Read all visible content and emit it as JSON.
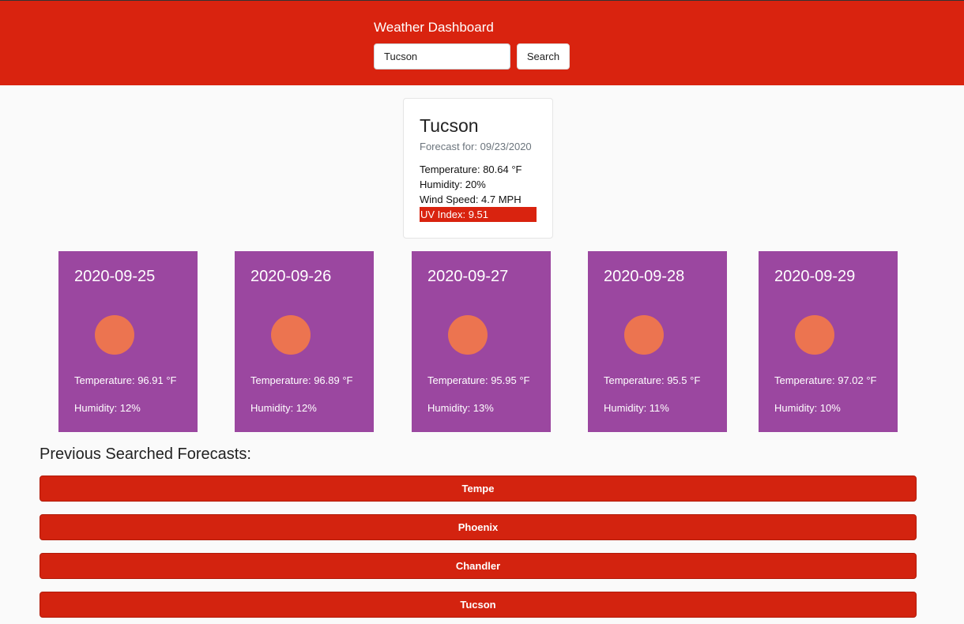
{
  "header": {
    "title": "Weather Dashboard",
    "search_value": "Tucson",
    "search_button_label": "Search"
  },
  "current": {
    "city": "Tucson",
    "date_prefix": "Forecast for:",
    "date": "09/23/2020",
    "temperature": "Temperature: 80.64 °F",
    "humidity": "Humidity: 20%",
    "wind_speed": "Wind Speed: 4.7 MPH",
    "uv_index": "UV Index: 9.51"
  },
  "forecast": [
    {
      "date": "2020-09-25",
      "icon": "sun-icon",
      "temperature": "Temperature: 96.91 °F",
      "humidity": "Humidity: 12%"
    },
    {
      "date": "2020-09-26",
      "icon": "sun-icon",
      "temperature": "Temperature: 96.89 °F",
      "humidity": "Humidity: 12%"
    },
    {
      "date": "2020-09-27",
      "icon": "sun-icon",
      "temperature": "Temperature: 95.95 °F",
      "humidity": "Humidity: 13%"
    },
    {
      "date": "2020-09-28",
      "icon": "sun-icon",
      "temperature": "Temperature: 95.5 °F",
      "humidity": "Humidity: 11%"
    },
    {
      "date": "2020-09-29",
      "icon": "sun-icon",
      "temperature": "Temperature: 97.02 °F",
      "humidity": "Humidity: 10%"
    }
  ],
  "history": {
    "title": "Previous Searched Forecasts:",
    "cities": [
      "Tempe",
      "Phoenix",
      "Chandler",
      "Tucson"
    ]
  },
  "colors": {
    "header_bg": "#d9230f",
    "forecast_card_bg": "#9b47a0",
    "sun_icon": "#ec7450",
    "uv_badge": "#d9230f"
  }
}
